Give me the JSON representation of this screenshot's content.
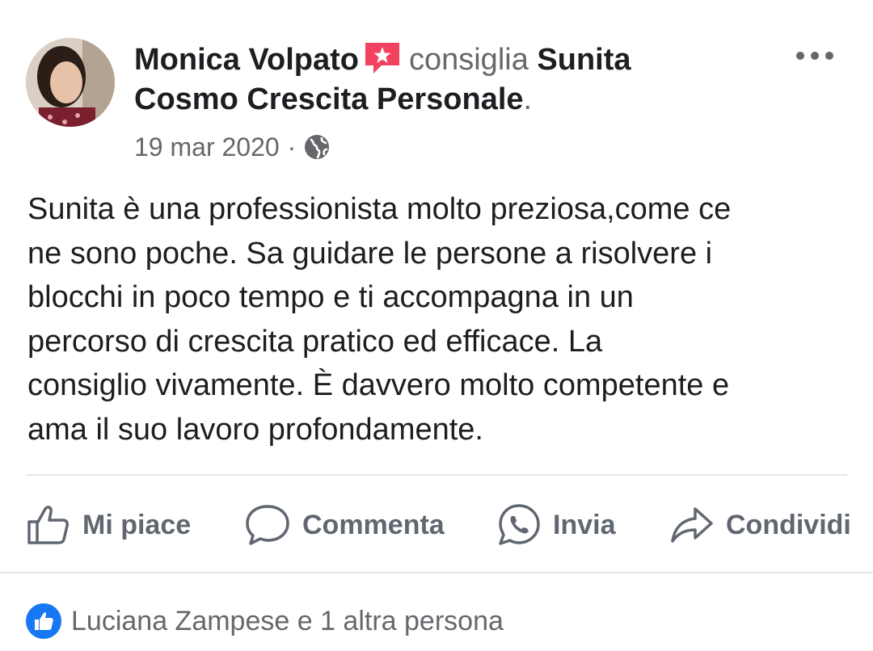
{
  "post": {
    "author": "Monica Volpato",
    "verb": "consiglia",
    "page_name": "Sunita Cosmo Crescita Personale",
    "page_name_line1": "Sunita",
    "page_name_line2": "Cosmo Crescita Personale",
    "period": ".",
    "date": "19 mar 2020",
    "separator": "·",
    "audience_icon": "globe-icon",
    "text_lines": [
      "Sunita è una professionista molto preziosa,come ce",
      "ne sono poche. Sa guidare le persone a risolvere i",
      "blocchi in poco tempo e ti accompagna in un",
      "percorso di crescita pratico ed efficace. La",
      "consiglio vivamente. È davvero molto competente e",
      "ama il suo lavoro profondamente."
    ]
  },
  "actions": {
    "like": "Mi piace",
    "comment": "Commenta",
    "send": "Invia",
    "share": "Condividi"
  },
  "reactions": {
    "summary": "Luciana Zampese e 1 altra persona"
  },
  "colors": {
    "accent": "#1877f2",
    "recommend_badge": "#f3425f",
    "secondary_text": "#65676b"
  }
}
